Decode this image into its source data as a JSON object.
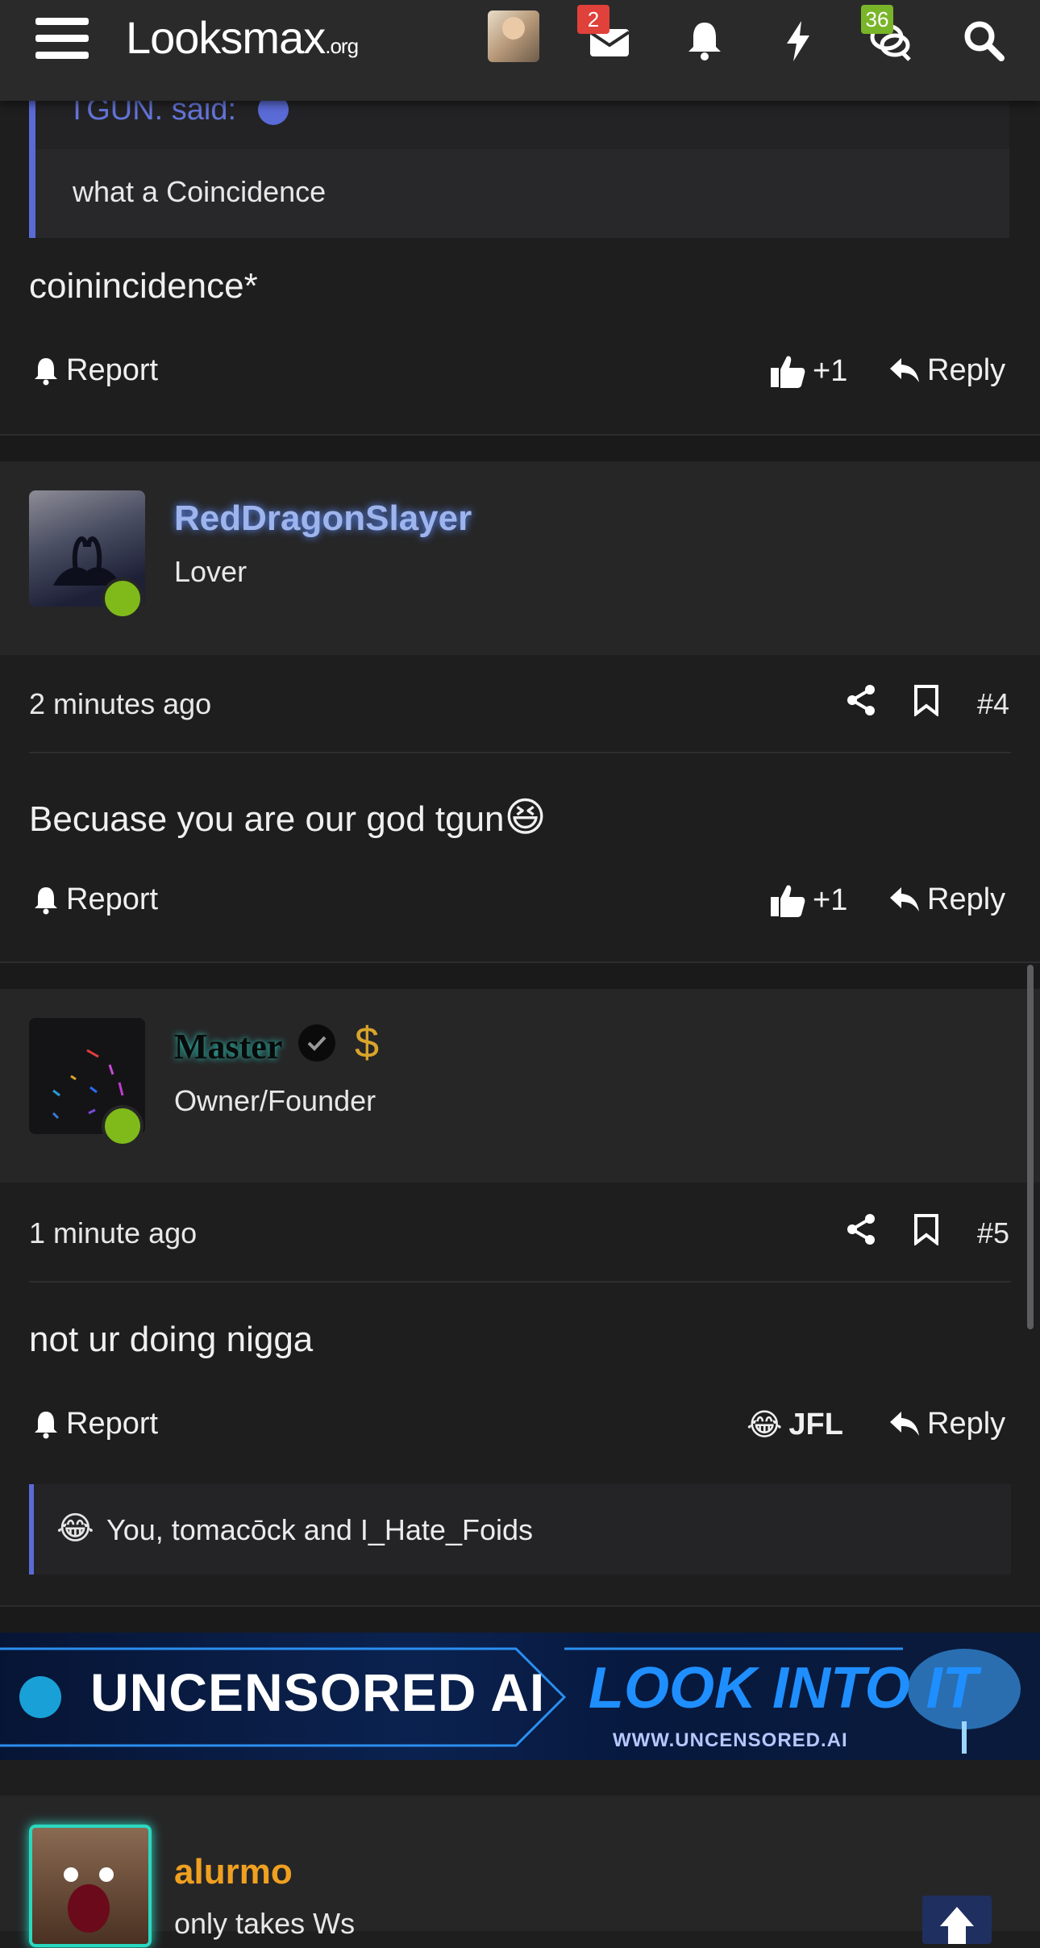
{
  "topbar": {
    "logo_main": "Looksmax",
    "logo_suffix": ".org",
    "inbox_badge": "2",
    "chat_badge": "36",
    "icons": [
      "menu-icon",
      "inbox-icon",
      "bell-icon",
      "lightning-icon",
      "chat-icon",
      "search-icon"
    ]
  },
  "quote": {
    "author": "TGUN. said:",
    "text": "what a Coincidence"
  },
  "post3": {
    "text": "coinincidence*",
    "report": "Report",
    "likes": "+1",
    "reply": "Reply"
  },
  "post4": {
    "username": "RedDragonSlayer",
    "user_title": "Lover",
    "time": "2 minutes ago",
    "number": "#4",
    "text": "Becuase you are our god tgun",
    "emoji": "😆",
    "report": "Report",
    "likes": "+1",
    "reply": "Reply"
  },
  "post5": {
    "username": "Master",
    "user_title": "Owner/Founder",
    "time": "1 minute ago",
    "number": "#5",
    "text": "not ur doing nigga",
    "report": "Report",
    "reaction_emoji": "😂",
    "reaction_label": "JFL",
    "reply": "Reply",
    "reacted_by": "You, tomacōck and I_Hate_Foids",
    "dollar": "$"
  },
  "banner": {
    "left_text": "UNCENSORED AI",
    "right_text": "LOOK INTO IT",
    "url": "WWW.UNCENSORED.AI"
  },
  "post6": {
    "username": "alurmo",
    "user_title": "only takes Ws"
  },
  "colors": {
    "accent": "#5a6bd6",
    "online": "#7fba1a",
    "alurmo": "#f0a020"
  }
}
